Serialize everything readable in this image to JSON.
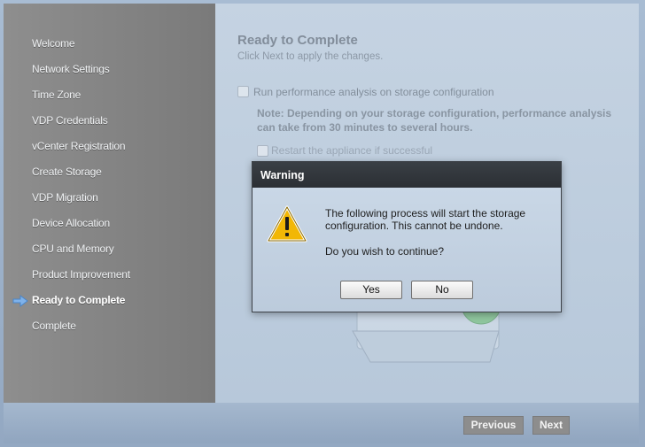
{
  "sidebar": {
    "items": [
      {
        "label": "Welcome"
      },
      {
        "label": "Network Settings"
      },
      {
        "label": "Time Zone"
      },
      {
        "label": "VDP Credentials"
      },
      {
        "label": "vCenter Registration"
      },
      {
        "label": "Create Storage"
      },
      {
        "label": "VDP Migration"
      },
      {
        "label": "Device Allocation"
      },
      {
        "label": "CPU and Memory"
      },
      {
        "label": "Product Improvement"
      },
      {
        "label": "Ready to Complete"
      },
      {
        "label": "Complete"
      }
    ],
    "current_index": 10
  },
  "page": {
    "title": "Ready to Complete",
    "subtitle": "Click Next to apply the changes.",
    "option_performance": "Run performance analysis on storage configuration",
    "note_line1": "Note: Depending on your storage configuration, performance analysis",
    "note_line2": "can take from 30 minutes to several hours.",
    "option_restart": "Restart the appliance if successful"
  },
  "footer": {
    "previous_label": "Previous",
    "next_label": "Next"
  },
  "dialog": {
    "title": "Warning",
    "message_line1": "The following process will start the storage",
    "message_line2": "configuration.  This cannot be undone.",
    "question": "Do you wish to continue?",
    "yes_label": "Yes",
    "no_label": "No",
    "icon": "warning-icon"
  },
  "colors": {
    "dialog_titlebar": "#2f3338",
    "warning_yellow": "#f2b705",
    "sidebar": "#858585",
    "content_bg": "#c0cfdf"
  }
}
